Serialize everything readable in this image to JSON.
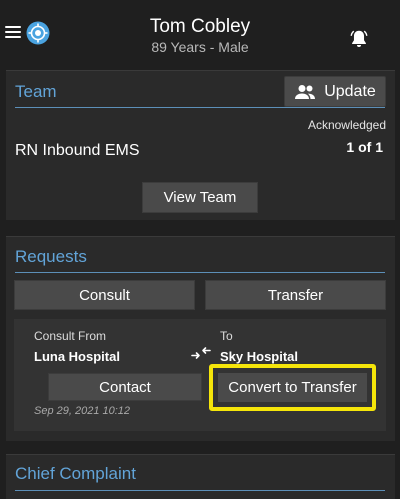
{
  "header": {
    "patient_name": "Tom Cobley",
    "patient_sub": "89 Years - Male"
  },
  "team": {
    "title": "Team",
    "update_label": "Update",
    "member": "RN Inbound EMS",
    "acknowledged_label": "Acknowledged",
    "acknowledged_count": "1 of 1",
    "view_team_label": "View Team"
  },
  "requests": {
    "title": "Requests",
    "consult_label": "Consult",
    "transfer_label": "Transfer",
    "item": {
      "from_label": "Consult From",
      "from_value": "Luna Hospital",
      "to_label": "To",
      "to_value": "Sky Hospital",
      "contact_label": "Contact",
      "convert_label": "Convert to Transfer",
      "timestamp": "Sep 29, 2021 10:12"
    }
  },
  "chief_complaint": {
    "title": "Chief Complaint"
  },
  "icons": {
    "menu": "menu-icon",
    "logo": "app-logo-icon",
    "bell": "bell-icon",
    "people": "people-icon",
    "swap": "swap-arrows-icon"
  },
  "colors": {
    "background": "#1f1f1f",
    "card": "#2a2a2a",
    "accent": "#62a4d8",
    "button": "#4a4a4a",
    "highlight": "#f5e50a"
  }
}
